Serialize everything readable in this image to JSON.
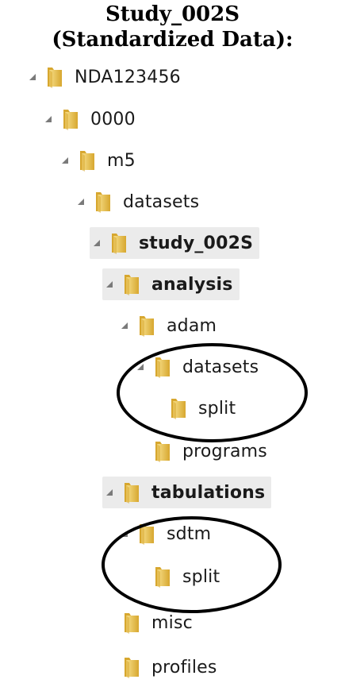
{
  "title": {
    "line1": "Study_002S",
    "line2": "(Standardized Data):"
  },
  "tree": [
    {
      "label": "NDA123456",
      "expanded": true
    },
    {
      "label": "0000",
      "expanded": true
    },
    {
      "label": "m5",
      "expanded": true
    },
    {
      "label": "datasets",
      "expanded": true
    },
    {
      "label": "study_002S",
      "expanded": true,
      "bold": true
    },
    {
      "label": "analysis",
      "expanded": true,
      "bold": true
    },
    {
      "label": "adam",
      "expanded": true
    },
    {
      "label": "datasets",
      "expanded": true
    },
    {
      "label": "split",
      "expanded": false
    },
    {
      "label": "programs",
      "expanded": false
    },
    {
      "label": "tabulations",
      "expanded": true,
      "bold": true
    },
    {
      "label": "sdtm",
      "expanded": true
    },
    {
      "label": "split",
      "expanded": false
    },
    {
      "label": "misc",
      "expanded": false
    },
    {
      "label": "profiles",
      "expanded": false
    }
  ],
  "icons": {
    "expander": "expanded-triangle-icon",
    "folder": "folder-icon"
  },
  "colors": {
    "folder_light": "#f8e08a",
    "folder_dark": "#d7a72f",
    "triangle": "#7a7a7a",
    "highlight": "#ebebeb",
    "ring": "#000000"
  }
}
